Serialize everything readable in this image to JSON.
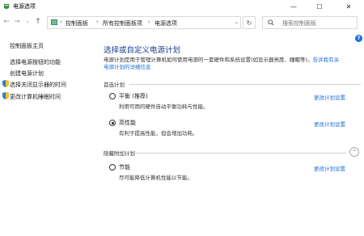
{
  "window": {
    "title": "电源选项",
    "minimize": "—",
    "maximize": "☐",
    "close": "✕"
  },
  "nav": {
    "back": "←",
    "forward": "→",
    "recent": "⌄",
    "up": "↑",
    "breadcrumbs": [
      "控制面板",
      "所有控制面板项",
      "电源选项"
    ],
    "separator": "›",
    "address_dropdown": "⌄",
    "refresh": "↻",
    "search_placeholder": "搜索控制面板"
  },
  "help": "?",
  "sidebar": {
    "home": "控制面板主页",
    "items": [
      {
        "label": "选择电源按钮的功能",
        "icon": ""
      },
      {
        "label": "创建电源计划",
        "icon": ""
      },
      {
        "label": "选择关闭显示器的时间",
        "icon": "shield-icon"
      },
      {
        "label": "更改计算机睡眠时间",
        "icon": "shield-icon"
      }
    ]
  },
  "main": {
    "heading": "选择或自定义电源计划",
    "description_line1": "电源计划是用于管理计算机如何使用电源的一套硬件和系统设置(如显示器亮度、睡眠等)。",
    "description_link1": "告诉我有关",
    "description_link2": "电源计划的详细信息",
    "preferred_label": "首选计划",
    "hidden_label": "隐藏附加计划",
    "collapse_icon": "⌃",
    "plans": [
      {
        "name": "平衡 (推荐)",
        "desc": "利用可用的硬件自动平衡功耗与性能。",
        "link": "更改计划设置",
        "checked": false
      },
      {
        "name": "高性能",
        "desc": "有利于提高性能，但会增加功耗。",
        "link": "更改计划设置",
        "checked": true
      },
      {
        "name": "节能",
        "desc": "尽可能降低计算机性能以节能。",
        "link": "更改计划设置",
        "checked": false
      }
    ]
  },
  "colors": {
    "heading": "#1a3a8f",
    "link": "#1d6fd6"
  }
}
